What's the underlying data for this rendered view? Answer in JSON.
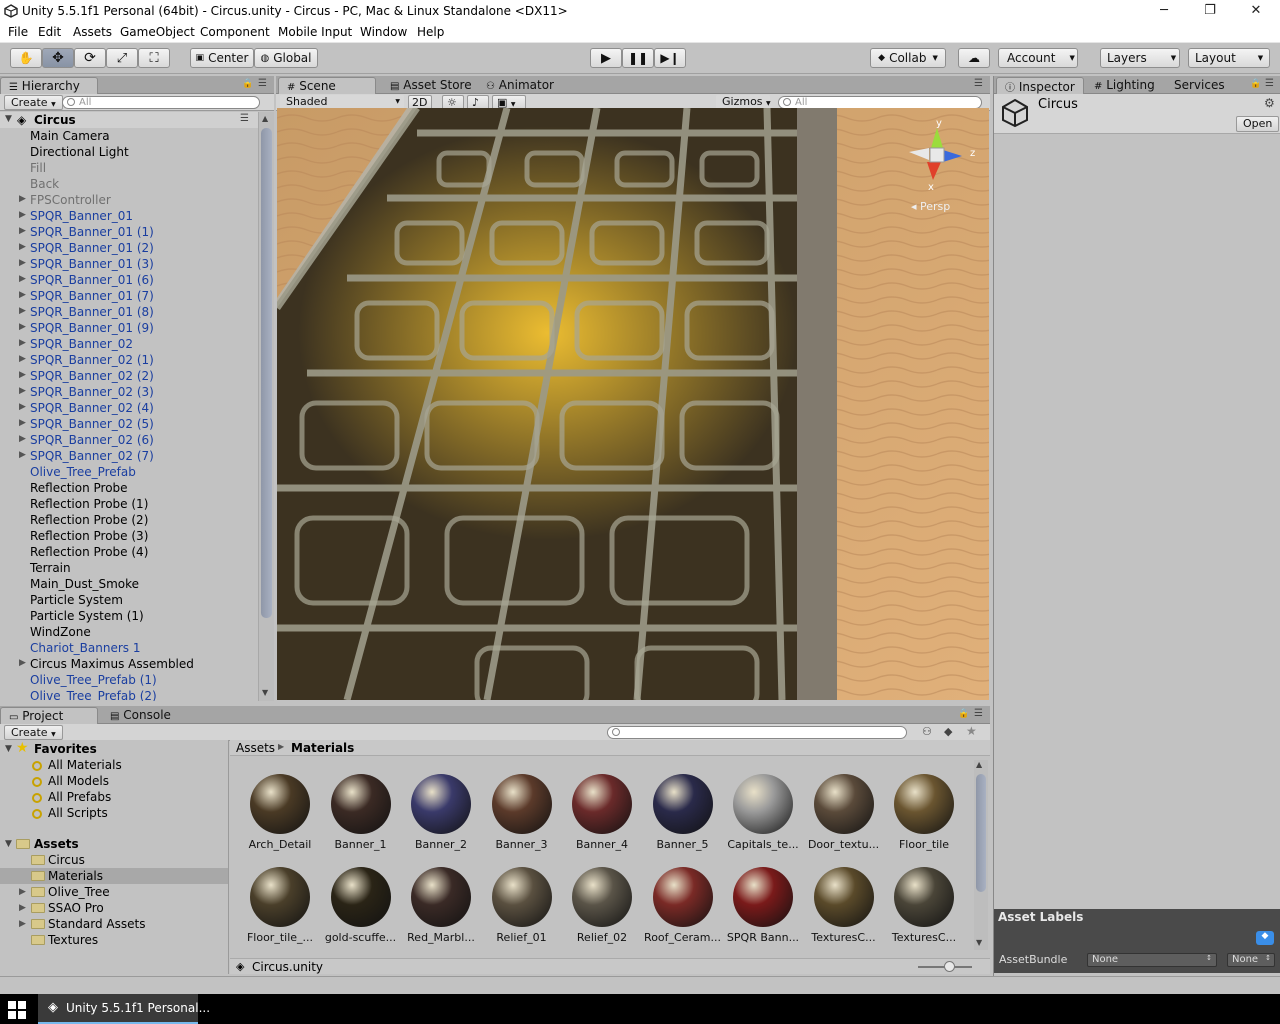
{
  "window": {
    "title": "Unity 5.5.1f1 Personal (64bit) - Circus.unity - Circus - PC, Mac & Linux Standalone <DX11>",
    "controls": [
      "─",
      "❐",
      "✕"
    ]
  },
  "menu": [
    "File",
    "Edit",
    "Assets",
    "GameObject",
    "Component",
    "Mobile Input",
    "Window",
    "Help"
  ],
  "toolbar": {
    "tools": [
      "hand-icon",
      "move-icon",
      "rotate-icon",
      "scale-icon",
      "rect-icon"
    ],
    "pivot": "Center",
    "space": "Global",
    "play_icons": [
      "play-icon",
      "pause-icon",
      "step-icon"
    ],
    "collab": "Collab",
    "account": "Account",
    "layers": "Layers",
    "layout": "Layout"
  },
  "hierarchy": {
    "tab": "Hierarchy",
    "create": "Create",
    "search_placeholder": "All",
    "scene_name": "Circus",
    "items": [
      {
        "label": "Main Camera",
        "style": "normal",
        "expandable": false
      },
      {
        "label": "Directional Light",
        "style": "normal",
        "expandable": false
      },
      {
        "label": "Fill",
        "style": "disabled",
        "expandable": false
      },
      {
        "label": "Back",
        "style": "disabled",
        "expandable": false
      },
      {
        "label": "FPSController",
        "style": "disabled",
        "expandable": true
      },
      {
        "label": "SPQR_Banner_01",
        "style": "prefab",
        "expandable": true
      },
      {
        "label": "SPQR_Banner_01 (1)",
        "style": "prefab",
        "expandable": true
      },
      {
        "label": "SPQR_Banner_01 (2)",
        "style": "prefab",
        "expandable": true
      },
      {
        "label": "SPQR_Banner_01 (3)",
        "style": "prefab",
        "expandable": true
      },
      {
        "label": "SPQR_Banner_01 (6)",
        "style": "prefab",
        "expandable": true
      },
      {
        "label": "SPQR_Banner_01 (7)",
        "style": "prefab",
        "expandable": true
      },
      {
        "label": "SPQR_Banner_01 (8)",
        "style": "prefab",
        "expandable": true
      },
      {
        "label": "SPQR_Banner_01 (9)",
        "style": "prefab",
        "expandable": true
      },
      {
        "label": "SPQR_Banner_02",
        "style": "prefab",
        "expandable": true
      },
      {
        "label": "SPQR_Banner_02 (1)",
        "style": "prefab",
        "expandable": true
      },
      {
        "label": "SPQR_Banner_02 (2)",
        "style": "prefab",
        "expandable": true
      },
      {
        "label": "SPQR_Banner_02 (3)",
        "style": "prefab",
        "expandable": true
      },
      {
        "label": "SPQR_Banner_02 (4)",
        "style": "prefab",
        "expandable": true
      },
      {
        "label": "SPQR_Banner_02 (5)",
        "style": "prefab",
        "expandable": true
      },
      {
        "label": "SPQR_Banner_02 (6)",
        "style": "prefab",
        "expandable": true
      },
      {
        "label": "SPQR_Banner_02 (7)",
        "style": "prefab",
        "expandable": true
      },
      {
        "label": "Olive_Tree_Prefab",
        "style": "prefab",
        "expandable": false
      },
      {
        "label": "Reflection Probe",
        "style": "normal",
        "expandable": false
      },
      {
        "label": "Reflection Probe (1)",
        "style": "normal",
        "expandable": false
      },
      {
        "label": "Reflection Probe (2)",
        "style": "normal",
        "expandable": false
      },
      {
        "label": "Reflection Probe (3)",
        "style": "normal",
        "expandable": false
      },
      {
        "label": "Reflection Probe (4)",
        "style": "normal",
        "expandable": false
      },
      {
        "label": "Terrain",
        "style": "normal",
        "expandable": false
      },
      {
        "label": "Main_Dust_Smoke",
        "style": "normal",
        "expandable": false
      },
      {
        "label": "Particle System",
        "style": "normal",
        "expandable": false
      },
      {
        "label": "Particle System (1)",
        "style": "normal",
        "expandable": false
      },
      {
        "label": "WindZone",
        "style": "normal",
        "expandable": false
      },
      {
        "label": "Chariot_Banners 1",
        "style": "prefab",
        "expandable": false
      },
      {
        "label": "Circus Maximus Assembled",
        "style": "normal",
        "expandable": true
      },
      {
        "label": "Olive_Tree_Prefab (1)",
        "style": "prefab",
        "expandable": false
      },
      {
        "label": "Olive_Tree_Prefab (2)",
        "style": "prefab",
        "expandable": false
      }
    ]
  },
  "scene": {
    "tabs": [
      "Scene",
      "Asset Store",
      "Animator"
    ],
    "shading": "Shaded",
    "mode2d": "2D",
    "gizmos": "Gizmos",
    "search_placeholder": "All",
    "gizmo_axes": {
      "y": "y",
      "z": "z",
      "x": "x"
    },
    "projection": "◂ Persp"
  },
  "inspector": {
    "tabs": [
      "Inspector",
      "Lighting",
      "Services"
    ],
    "object_name": "Circus",
    "open_button": "Open",
    "asset_labels": "Asset Labels",
    "asset_bundle_label": "AssetBundle",
    "asset_bundle_value": "None",
    "asset_bundle_variant": "None"
  },
  "project": {
    "tabs": [
      "Project",
      "Console"
    ],
    "create": "Create",
    "favorites_label": "Favorites",
    "favorites": [
      "All Materials",
      "All Models",
      "All Prefabs",
      "All Scripts"
    ],
    "assets_label": "Assets",
    "folders": [
      {
        "label": "Circus",
        "expandable": false
      },
      {
        "label": "Materials",
        "expandable": false
      },
      {
        "label": "Olive_Tree",
        "expandable": true
      },
      {
        "label": "SSAO Pro",
        "expandable": true
      },
      {
        "label": "Standard Assets",
        "expandable": true
      },
      {
        "label": "Textures",
        "expandable": false
      }
    ],
    "breadcrumb": [
      "Assets",
      "Materials"
    ],
    "materials": [
      {
        "label": "Arch_Detail",
        "color": "#4a3a25"
      },
      {
        "label": "Banner_1",
        "color": "#3b2a24"
      },
      {
        "label": "Banner_2",
        "color": "#3a3a6a"
      },
      {
        "label": "Banner_3",
        "color": "#5b3a2a"
      },
      {
        "label": "Banner_4",
        "color": "#6a2a2a"
      },
      {
        "label": "Banner_5",
        "color": "#2a2a4a"
      },
      {
        "label": "Capitals_te...",
        "color": "#9a9a9a"
      },
      {
        "label": "Door_textu...",
        "color": "#5a4a3a"
      },
      {
        "label": "Floor_tile",
        "color": "#6a5530"
      },
      {
        "label": "Floor_tile_...",
        "color": "#4a3f2a"
      },
      {
        "label": "gold-scuffe...",
        "color": "#2a2416"
      },
      {
        "label": "Red_Marbl...",
        "color": "#3a2a26"
      },
      {
        "label": "Relief_01",
        "color": "#5a5040"
      },
      {
        "label": "Relief_02",
        "color": "#5a5448"
      },
      {
        "label": "Roof_Ceram...",
        "color": "#7a2a26"
      },
      {
        "label": "SPQR Bann...",
        "color": "#7a1a1a"
      },
      {
        "label": "TexturesC...",
        "color": "#5a4a2a"
      },
      {
        "label": "TexturesC...",
        "color": "#4a4538"
      }
    ],
    "footer_file": "Circus.unity"
  },
  "taskbar": {
    "app_label": "Unity 5.5.1f1 Personal..."
  }
}
